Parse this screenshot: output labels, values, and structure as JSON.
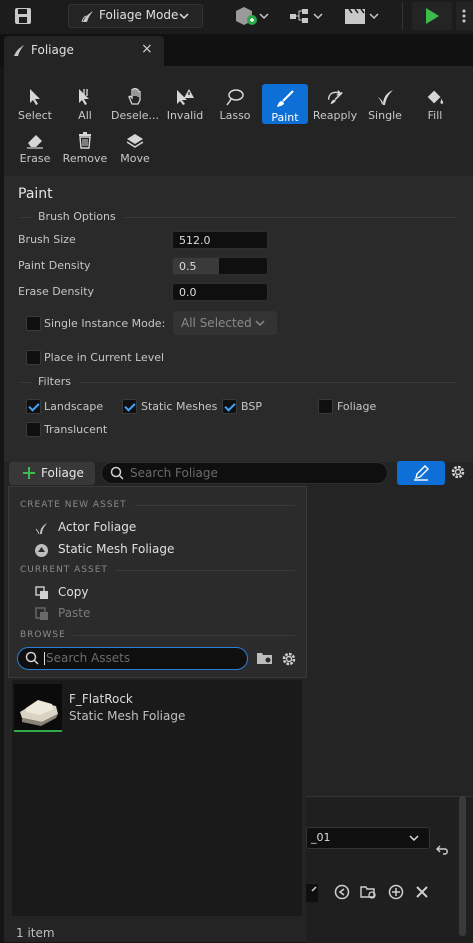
{
  "toolbar": {
    "mode_label": "Foliage Mode"
  },
  "tab": {
    "title": "Foliage",
    "close": "×"
  },
  "tools": [
    {
      "label": "Select",
      "icon": "cursor-icon"
    },
    {
      "label": "All",
      "icon": "select-all-icon"
    },
    {
      "label": "Desele...",
      "icon": "deselect-hand-icon"
    },
    {
      "label": "Invalid",
      "icon": "invalid-cursor-icon"
    },
    {
      "label": "Lasso",
      "icon": "lasso-icon"
    },
    {
      "label": "Paint",
      "icon": "paintbrush-icon",
      "active": true
    },
    {
      "label": "Reapply",
      "icon": "reapply-icon"
    },
    {
      "label": "Single",
      "icon": "single-foliage-icon"
    },
    {
      "label": "Fill",
      "icon": "fill-bucket-icon"
    },
    {
      "label": "Erase",
      "icon": "eraser-icon"
    },
    {
      "label": "Remove",
      "icon": "trash-icon"
    },
    {
      "label": "Move",
      "icon": "move-icon"
    }
  ],
  "paint": {
    "title": "Paint",
    "brush_options_label": "Brush Options",
    "brush_size_label": "Brush Size",
    "brush_size_value": "512.0",
    "paint_density_label": "Paint Density",
    "paint_density_value": "0.5",
    "erase_density_label": "Erase Density",
    "erase_density_value": "0.0",
    "single_instance_label": "Single Instance Mode:",
    "single_instance_value": "All Selected",
    "place_in_level_label": "Place in Current Level",
    "filters_label": "Filters",
    "filters": {
      "landscape": "Landscape",
      "static_meshes": "Static Meshes",
      "bsp": "BSP",
      "foliage": "Foliage",
      "translucent": "Translucent"
    }
  },
  "foliage_bar": {
    "add_label": "Foliage",
    "search_placeholder": "Search Foliage"
  },
  "dropdown": {
    "create_header": "CREATE NEW ASSET",
    "actor_foliage": "Actor Foliage",
    "static_mesh_foliage": "Static Mesh Foliage",
    "current_header": "CURRENT ASSET",
    "copy": "Copy",
    "paste": "Paste",
    "browse_header": "BROWSE",
    "search_placeholder": "Search Assets"
  },
  "asset": {
    "name": "F_FlatRock",
    "type": "Static Mesh Foliage"
  },
  "footer": {
    "count": "1 item"
  },
  "background_panel": {
    "combo_value": "_01"
  }
}
